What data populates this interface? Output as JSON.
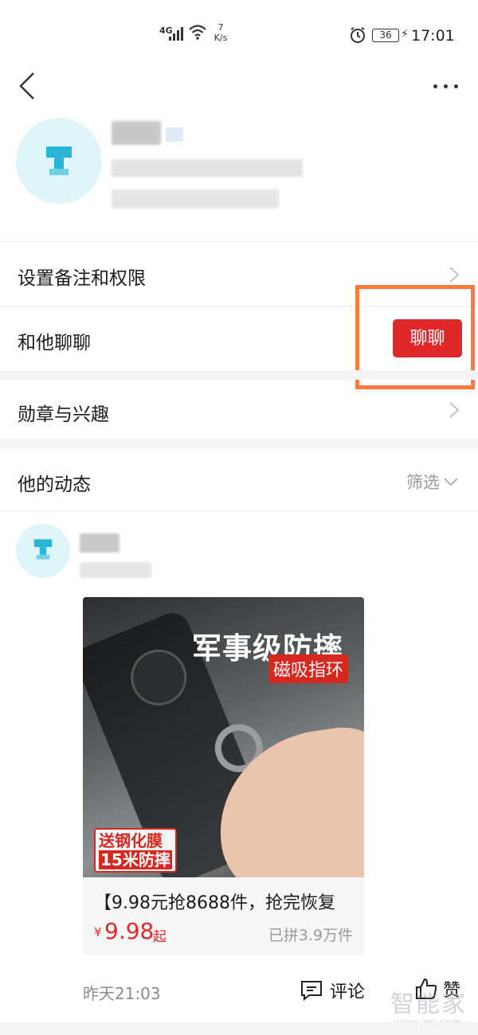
{
  "status_bar": {
    "network": "4G",
    "speed_value": "7",
    "speed_unit": "K/s",
    "battery": "36",
    "time": "17:01"
  },
  "profile": {
    "name_blurred": true
  },
  "menu": {
    "settings_label": "设置备注和权限",
    "chat_label": "和他聊聊",
    "chat_button": "聊聊",
    "badges_label": "勋章与兴趣"
  },
  "feed": {
    "title": "他的动态",
    "filter_label": "筛选"
  },
  "post": {
    "image": {
      "headline": "军事级防摔",
      "tag": "磁吸指环",
      "sticker_line1": "送钢化膜",
      "sticker_line2": "15米防摔"
    },
    "product_title": "【9.98元抢8688件，抢完恢复",
    "price_symbol": "¥",
    "price": "9.98",
    "price_suffix": "起",
    "sold": "已拼3.9万件",
    "time": "昨天21:03",
    "comment_label": "评论",
    "like_label": "赞"
  },
  "watermark": {
    "brand": "智能家",
    "url": "www.znj.com"
  },
  "colors": {
    "accent_red": "#e0282b",
    "highlight_orange": "#ff7a3d"
  }
}
